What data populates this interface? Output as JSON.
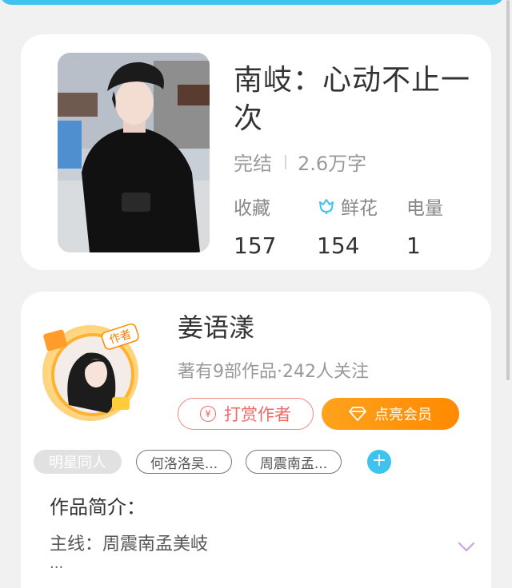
{
  "book": {
    "title": "南岐：心动不止一次",
    "status": "完结",
    "word_count": "2.6万字",
    "stats": [
      {
        "label": "收藏",
        "value": "157"
      },
      {
        "label": "鲜花",
        "value": "154"
      },
      {
        "label": "电量",
        "value": "1"
      }
    ]
  },
  "author": {
    "name": "姜语漾",
    "info": "著有9部作品·242人关注",
    "badge": "作者",
    "reward_button": "打赏作者",
    "vip_button": "点亮会员"
  },
  "tags": {
    "main": "明星同人",
    "items": [
      "何洛洛吴...",
      "周震南孟..."
    ]
  },
  "intro": {
    "title": "作品简介：",
    "text": "主线：周震南孟美岐",
    "more": "..."
  },
  "colors": {
    "accent": "#3ec3ef",
    "vip": "#ff8a00",
    "reward": "#ec6b69"
  }
}
